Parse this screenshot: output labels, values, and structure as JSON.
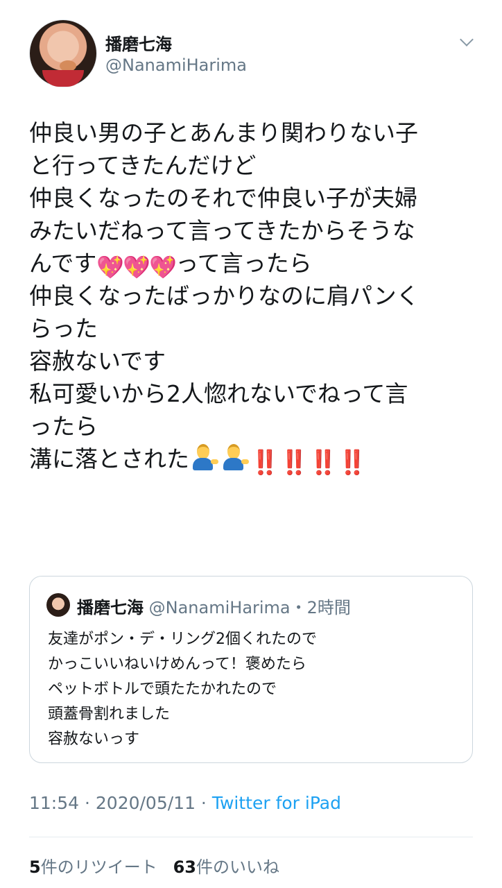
{
  "author": {
    "name": "播磨七海",
    "handle": "@NanamiHarima"
  },
  "tweet": {
    "lines": [
      "仲良い男の子とあんまり関わりない子",
      "と行ってきたんだけど",
      "仲良くなったのそれで仲良い子が夫婦",
      "みたいだねって言ってきたからそうな",
      "んです",
      "って言ったら",
      "仲良くなったばっかりなのに肩パンく",
      "らった",
      "容赦ないです",
      "私可愛いから2人惚れないでねって言",
      "ったら",
      "溝に落とされた"
    ],
    "emoji": {
      "heart": "💖",
      "person": "💁‍♂️",
      "bang": "‼️"
    }
  },
  "quoted": {
    "name": "播磨七海",
    "handle": "@NanamiHarima",
    "time": "・2時間",
    "lines": [
      "友達がポン・デ・リング2個くれたので",
      "かっこいいねいけめんって！褒めたら",
      "ペットボトルで頭たたかれたので",
      "頭蓋骨割れました",
      "容赦ないっす"
    ]
  },
  "meta": {
    "time": "11:54 · 2020/05/11 · ",
    "source": "Twitter for iPad"
  },
  "stats": {
    "retweet_count": "5",
    "retweet_label": "件のリツイート",
    "like_count": "63",
    "like_label": "件のいいね"
  },
  "colors": {
    "link": "#1da1f2",
    "muted": "#657786",
    "heart": "#e84f8d",
    "bang": "#dd2e44"
  }
}
